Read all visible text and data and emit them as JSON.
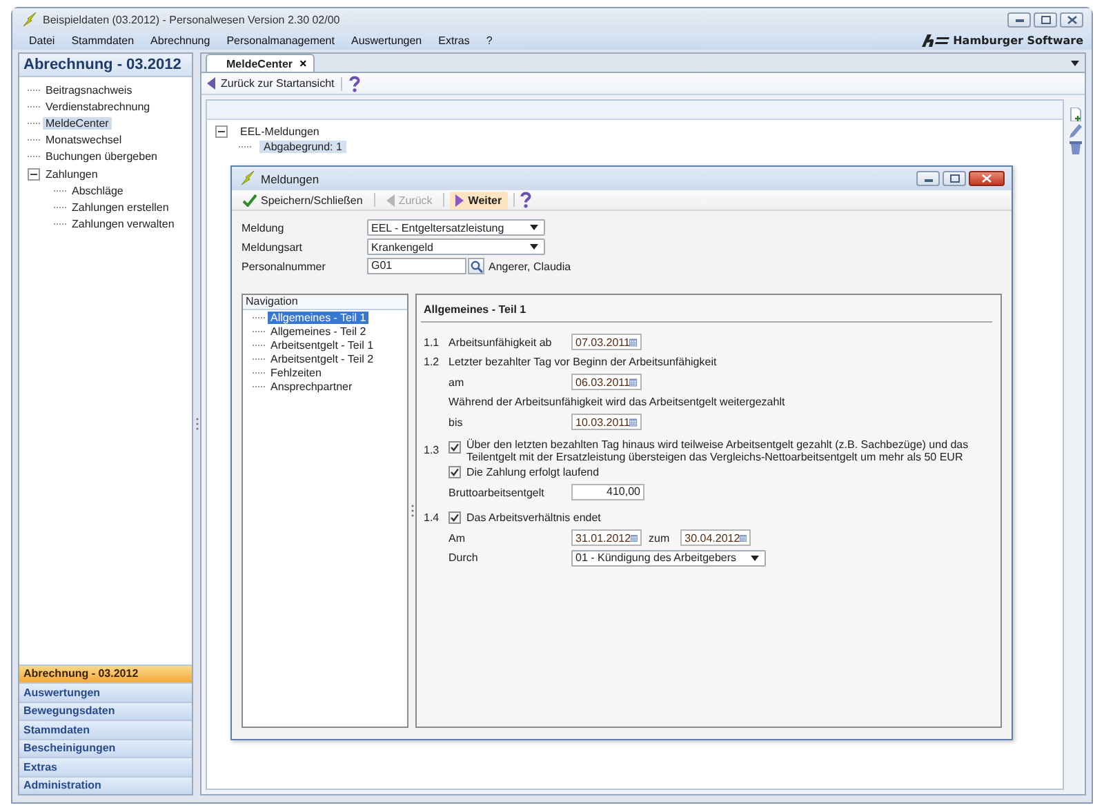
{
  "window": {
    "title": "Beispieldaten (03.2012) - Personalwesen Version 2.30 02/00",
    "brand": "Hamburger Software"
  },
  "menu": [
    "Datei",
    "Stammdaten",
    "Abrechnung",
    "Personalmanagement",
    "Auswertungen",
    "Extras",
    "?"
  ],
  "sidebar": {
    "title": "Abrechnung - 03.2012",
    "items": [
      {
        "label": "Beitragsnachweis",
        "selected": false
      },
      {
        "label": "Verdienstabrechnung",
        "selected": false
      },
      {
        "label": "MeldeCenter",
        "selected": true
      },
      {
        "label": "Monatswechsel",
        "selected": false
      },
      {
        "label": "Buchungen übergeben",
        "selected": false
      },
      {
        "label": "Zahlungen",
        "selected": false,
        "expanded": true,
        "children": [
          {
            "label": "Abschläge",
            "selected": false
          },
          {
            "label": "Zahlungen erstellen",
            "selected": false
          },
          {
            "label": "Zahlungen verwalten",
            "selected": false
          }
        ]
      }
    ]
  },
  "nav_bars": [
    {
      "label": "Abrechnung - 03.2012",
      "selected": true
    },
    {
      "label": "Auswertungen",
      "selected": false
    },
    {
      "label": "Bewegungsdaten",
      "selected": false
    },
    {
      "label": "Stammdaten",
      "selected": false
    },
    {
      "label": "Bescheinigungen",
      "selected": false
    },
    {
      "label": "Extras",
      "selected": false
    },
    {
      "label": "Administration",
      "selected": false
    }
  ],
  "tabs": [
    {
      "label": "MeldeCenter",
      "selected": true,
      "close": "×"
    }
  ],
  "toolbar": {
    "back": "Zurück zur Startansicht"
  },
  "tree": [
    {
      "label": "EEL-Meldungen",
      "expanded": true,
      "children": [
        {
          "label": "Abgabegrund: 1",
          "selected": true
        }
      ]
    }
  ],
  "dialog": {
    "title": "Meldungen",
    "toolbar": [
      {
        "kind": "save",
        "label": "Speichern/Schließen",
        "disabled": false,
        "highlighted": false
      },
      {
        "kind": "back",
        "label": "Zurück",
        "disabled": true,
        "highlighted": false
      },
      {
        "kind": "next",
        "label": "Weiter",
        "disabled": false,
        "highlighted": true
      },
      {
        "kind": "help"
      }
    ],
    "fields": [
      {
        "kind": "select",
        "label": "Meldung",
        "value": "EEL - Entgeltersatzleistung"
      },
      {
        "kind": "select",
        "label": "Meldungsart",
        "value": "Krankengeld"
      },
      {
        "kind": "lookup",
        "label": "Personalnummer",
        "value": "G01",
        "name": "Angerer, Claudia"
      }
    ],
    "navigation": {
      "title": "Navigation",
      "items": [
        {
          "label": "Allgemeines - Teil 1",
          "selected": true
        },
        {
          "label": "Allgemeines - Teil 2",
          "selected": false
        },
        {
          "label": "Arbeitsentgelt - Teil 1",
          "selected": false
        },
        {
          "label": "Arbeitsentgelt - Teil 2",
          "selected": false
        },
        {
          "label": "Fehlzeiten",
          "selected": false
        },
        {
          "label": "Ansprechpartner",
          "selected": false
        }
      ]
    },
    "section": {
      "title": "Allgemeines - Teil 1",
      "rows": [
        {
          "kind": "date",
          "number": "1.1",
          "label": "Arbeitsunfähigkeit ab",
          "value": "07.03.2011"
        },
        {
          "kind": "text",
          "number": "1.2",
          "label": "Letzter bezahlter Tag vor Beginn der Arbeitsunfähigkeit"
        },
        {
          "kind": "date",
          "label": "am",
          "value": "06.03.2011"
        },
        {
          "kind": "text",
          "label": "Während der Arbeitsunfähigkeit wird das Arbeitsentgelt weitergezahlt"
        },
        {
          "kind": "date",
          "label": "bis",
          "value": "10.03.2011"
        },
        {
          "kind": "check",
          "number": "1.3",
          "label": "Über den letzten bezahlten Tag hinaus wird teilweise Arbeitsentgelt gezahlt (z.B. Sachbezüge) und das Teilentgelt mit der Ersatzleistung übersteigen das Vergleichs-Nettoarbeitsentgelt um mehr als 50 EUR",
          "checked": true
        },
        {
          "kind": "check",
          "label": "Die Zahlung erfolgt laufend",
          "checked": true
        },
        {
          "kind": "amount",
          "label": "Bruttoarbeitsentgelt",
          "value": "410,00"
        },
        {
          "kind": "check",
          "number": "1.4",
          "label": "Das Arbeitsverhältnis endet",
          "checked": true
        },
        {
          "kind": "daterange",
          "label": "Am",
          "value": "31.01.2012",
          "joiner": "zum",
          "value2": "30.04.2012"
        },
        {
          "kind": "select",
          "label": "Durch",
          "value": "01 - Kündigung des Arbeitgebers"
        }
      ]
    }
  }
}
